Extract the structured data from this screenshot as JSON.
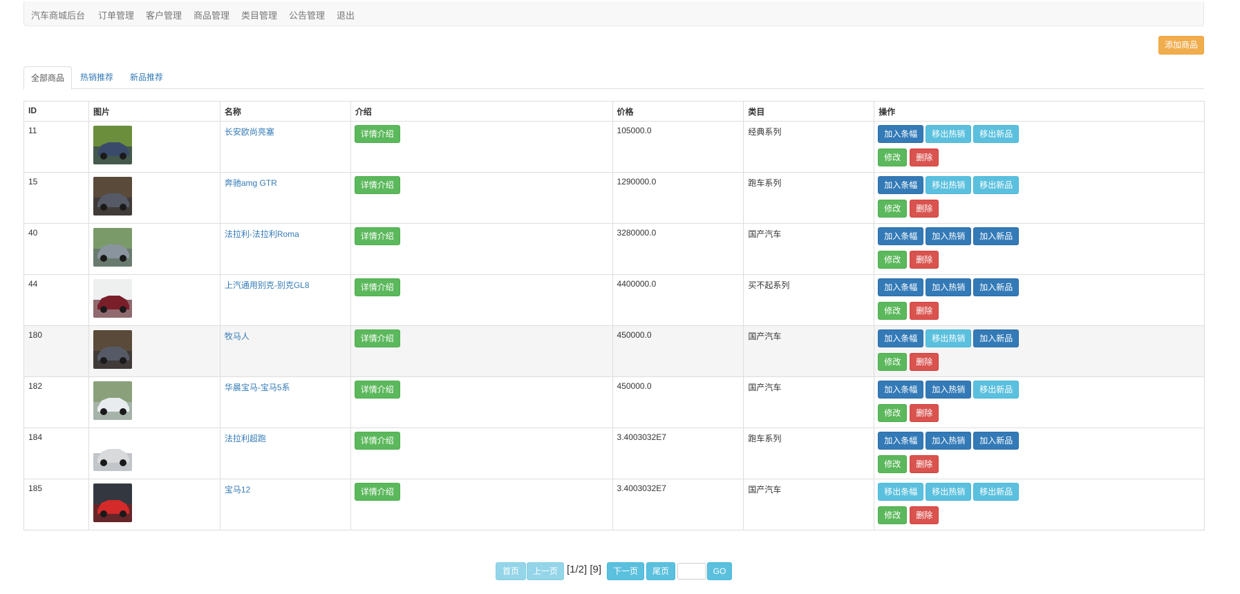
{
  "nav": {
    "brand": "汽车商城后台",
    "items": [
      "订单管理",
      "客户管理",
      "商品管理",
      "类目管理",
      "公告管理",
      "退出"
    ]
  },
  "add_button": "添加商品",
  "tabs": [
    "全部商品",
    "热销推荐",
    "新品推荐"
  ],
  "table": {
    "headers": [
      "ID",
      "图片",
      "名称",
      "介绍",
      "价格",
      "类目",
      "操作"
    ],
    "detail_label": "详情介绍",
    "edit_label": "修改",
    "delete_label": "删除",
    "rows": [
      {
        "id": "11",
        "name": "长安欧尚亮塞",
        "price": "105000.0",
        "category": "经典系列",
        "banner": "加入条幅",
        "hot": "移出热销",
        "new": "移出新品"
      },
      {
        "id": "15",
        "name": "奔驰amg GTR",
        "price": "1290000.0",
        "category": "跑车系列",
        "banner": "加入条幅",
        "hot": "移出热销",
        "new": "移出新品"
      },
      {
        "id": "40",
        "name": "法拉利-法拉利Roma",
        "price": "3280000.0",
        "category": "国产汽车",
        "banner": "加入条幅",
        "hot": "加入热销",
        "new": "加入新品"
      },
      {
        "id": "44",
        "name": "上汽通用别克-别克GL8",
        "price": "4400000.0",
        "category": "买不起系列",
        "banner": "加入条幅",
        "hot": "加入热销",
        "new": "加入新品"
      },
      {
        "id": "180",
        "name": "牧马人",
        "price": "450000.0",
        "category": "国产汽车",
        "banner": "加入条幅",
        "hot": "移出热销",
        "new": "加入新品"
      },
      {
        "id": "182",
        "name": "华晨宝马-宝马5系",
        "price": "450000.0",
        "category": "国产汽车",
        "banner": "加入条幅",
        "hot": "加入热销",
        "new": "移出新品"
      },
      {
        "id": "184",
        "name": "法拉利超跑",
        "price": "3.4003032E7",
        "category": "跑车系列",
        "banner": "加入条幅",
        "hot": "加入热销",
        "new": "加入新品"
      },
      {
        "id": "185",
        "name": "宝马12",
        "price": "3.4003032E7",
        "category": "国产汽车",
        "banner": "移出条幅",
        "hot": "移出热销",
        "new": "移出新品"
      }
    ]
  },
  "pager": {
    "first": "首页",
    "prev": "上一页",
    "info": "[1/2] [9]",
    "next": "下一页",
    "last": "尾页",
    "go": "GO",
    "go_value": ""
  },
  "colors": {
    "primary": "#337ab7",
    "info": "#5bc0de",
    "success": "#5cb85c",
    "danger": "#d9534f",
    "warning": "#f0ad4e"
  }
}
